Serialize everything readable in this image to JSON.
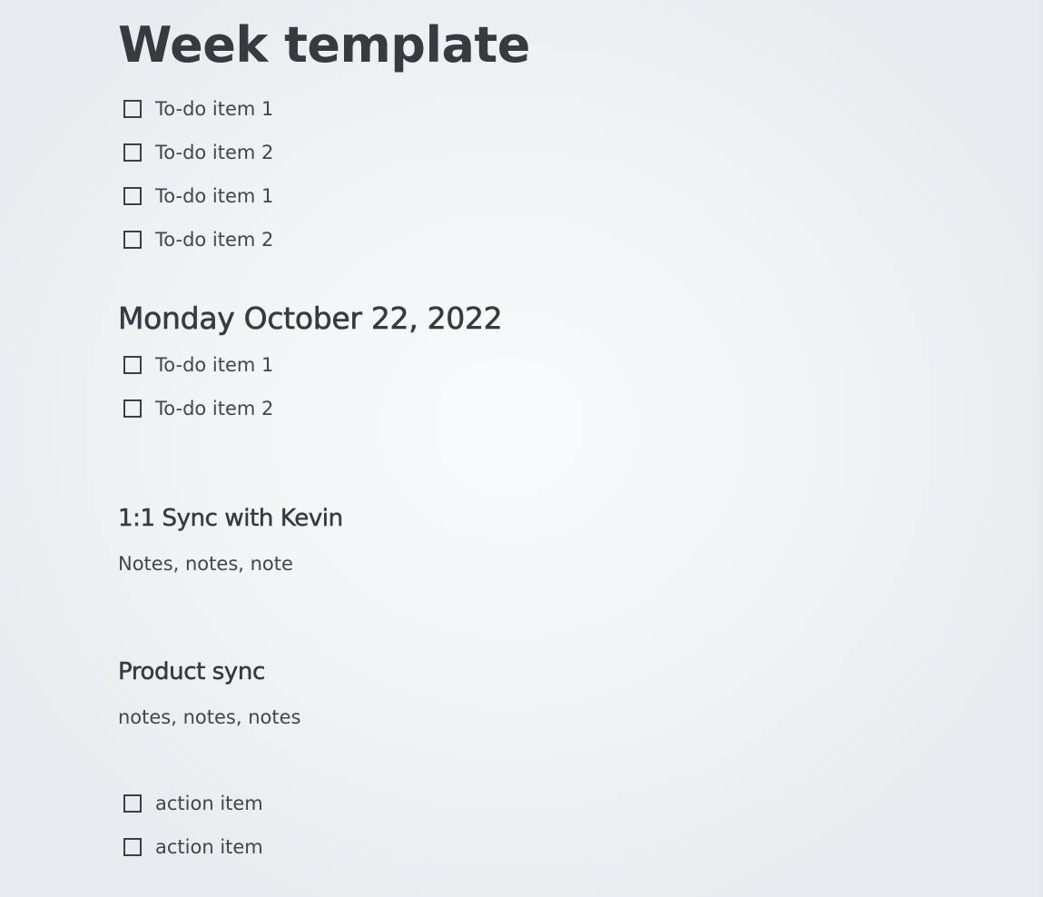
{
  "title": "Week template",
  "week_todos": [
    {
      "label": "To-do item 1",
      "checked": false
    },
    {
      "label": "To-do item 2",
      "checked": false
    },
    {
      "label": "To-do item 1",
      "checked": false
    },
    {
      "label": "To-do item 2",
      "checked": false
    }
  ],
  "day": {
    "heading": "Monday October 22, 2022",
    "todos": [
      {
        "label": "To-do item 1",
        "checked": false
      },
      {
        "label": "To-do item 2",
        "checked": false
      }
    ]
  },
  "meetings": [
    {
      "title": "1:1 Sync with Kevin",
      "notes": "Notes, notes, note"
    },
    {
      "title": "Product sync",
      "notes": "notes, notes, notes"
    }
  ],
  "action_items": [
    {
      "label": "action item",
      "checked": false
    },
    {
      "label": "action item",
      "checked": false
    }
  ],
  "colors": {
    "text": "#353b3f",
    "checkbox_border": "#3a4045",
    "background": "#f3f6f7"
  }
}
